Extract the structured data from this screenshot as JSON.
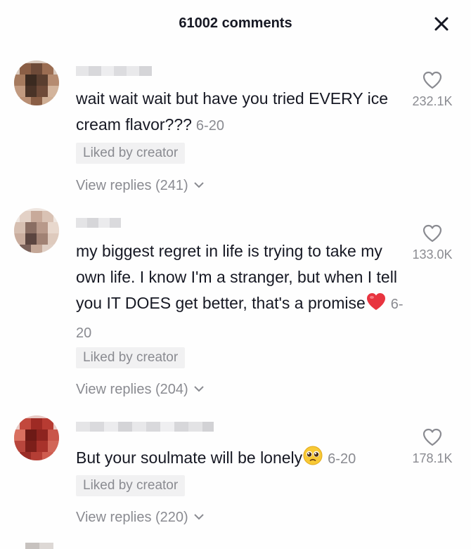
{
  "header": {
    "title": "61002 comments"
  },
  "comments": [
    {
      "text": "wait wait wait but have you tried EVERY ice cream flavor???",
      "date": "6-20",
      "badge": "Liked by creator",
      "replies": "View replies (241)",
      "likes": "232.1K",
      "avatar_colors": [
        "#6e4a38",
        "#8a5e45",
        "#3b2a20",
        "#a57a5e"
      ]
    },
    {
      "text": "my biggest regret in life is trying to take my own life. I know I'm a stranger, but when I tell you IT DOES get better, that's a promise",
      "emoji": "red-heart-emoji",
      "date": "6-20",
      "badge": "Liked by creator",
      "replies": "View replies (204)",
      "likes": "133.0K",
      "avatar_colors": [
        "#8a6e63",
        "#c8aa9a",
        "#5b4540",
        "#e3d1c6"
      ]
    },
    {
      "text": "But your soulmate will be lonely",
      "emoji": "pleading-face-emoji",
      "date": "6-20",
      "badge": "Liked by creator",
      "replies": "View replies (220)",
      "likes": "178.1K",
      "avatar_colors": [
        "#9e2a24",
        "#c2483d",
        "#6d1a16",
        "#d97060"
      ]
    }
  ],
  "colors": {
    "text": "#161823",
    "muted": "#8a8b91",
    "badge_bg": "#f1f1f2",
    "heart_red": "#e8343f"
  }
}
